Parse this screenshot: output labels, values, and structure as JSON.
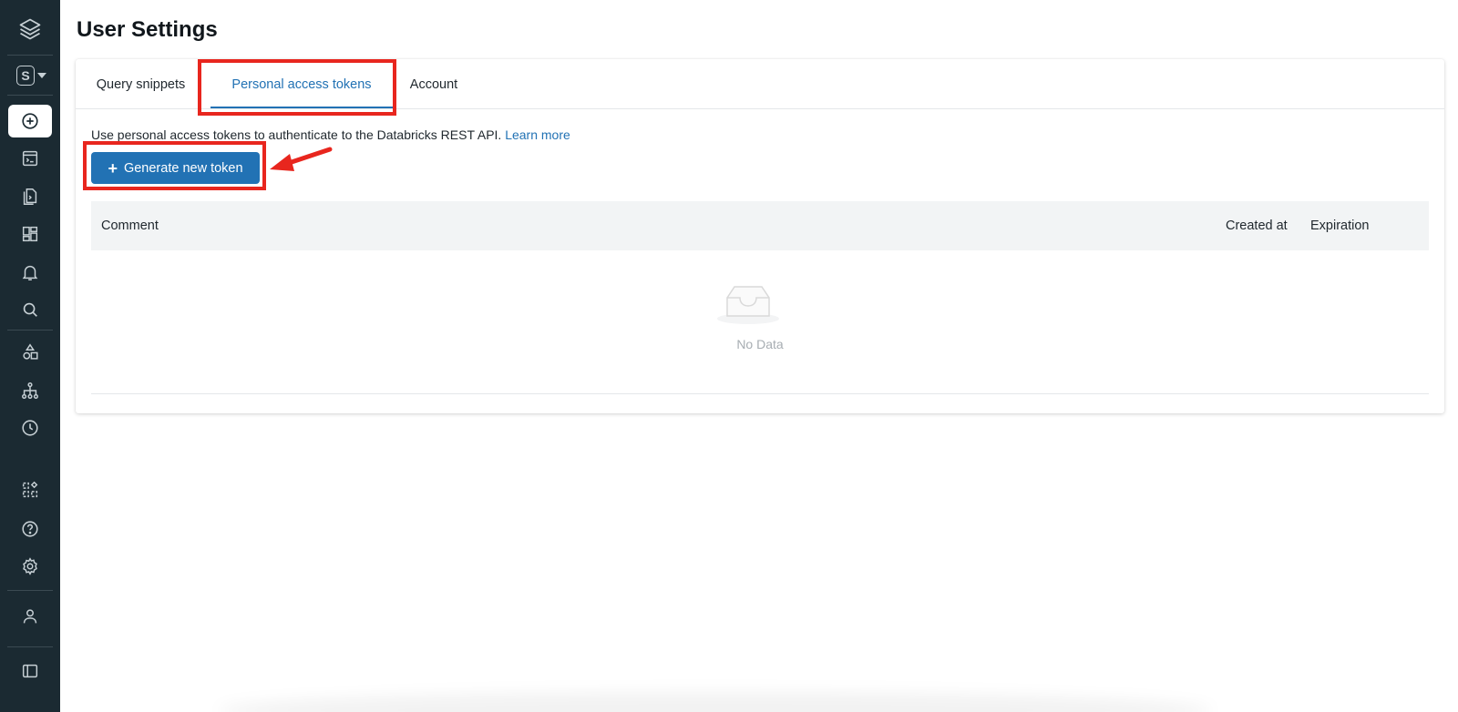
{
  "app": {
    "page_title": "User Settings",
    "workspace_badge": "S"
  },
  "sidebar": {
    "items": [
      {
        "icon": "layers-logo-icon"
      },
      {
        "icon": "workspace-switcher"
      },
      {
        "icon": "plus-circle-icon"
      },
      {
        "icon": "sql-editor-icon"
      },
      {
        "icon": "queries-icon"
      },
      {
        "icon": "dashboards-icon"
      },
      {
        "icon": "alerts-bell-icon"
      },
      {
        "icon": "search-icon"
      },
      {
        "icon": "shapes-icon"
      },
      {
        "icon": "hierarchy-icon"
      },
      {
        "icon": "history-clock-icon"
      },
      {
        "icon": "partner-connect-icon"
      },
      {
        "icon": "help-icon"
      },
      {
        "icon": "gear-icon"
      },
      {
        "icon": "user-icon"
      },
      {
        "icon": "collapse-sidebar-icon"
      }
    ]
  },
  "tabs": [
    {
      "label": "Query snippets",
      "active": false
    },
    {
      "label": "Personal access tokens",
      "active": true
    },
    {
      "label": "Account",
      "active": false
    }
  ],
  "tokens": {
    "description": "Use personal access tokens to authenticate to the Databricks REST API.",
    "learn_more": "Learn more",
    "generate_button": "Generate new token",
    "columns": [
      "Comment",
      "Created at",
      "Expiration"
    ],
    "empty_text": "No Data"
  },
  "colors": {
    "sidebar_bg": "#1b2a32",
    "accent": "#2272b4",
    "highlight": "#e8261e"
  }
}
